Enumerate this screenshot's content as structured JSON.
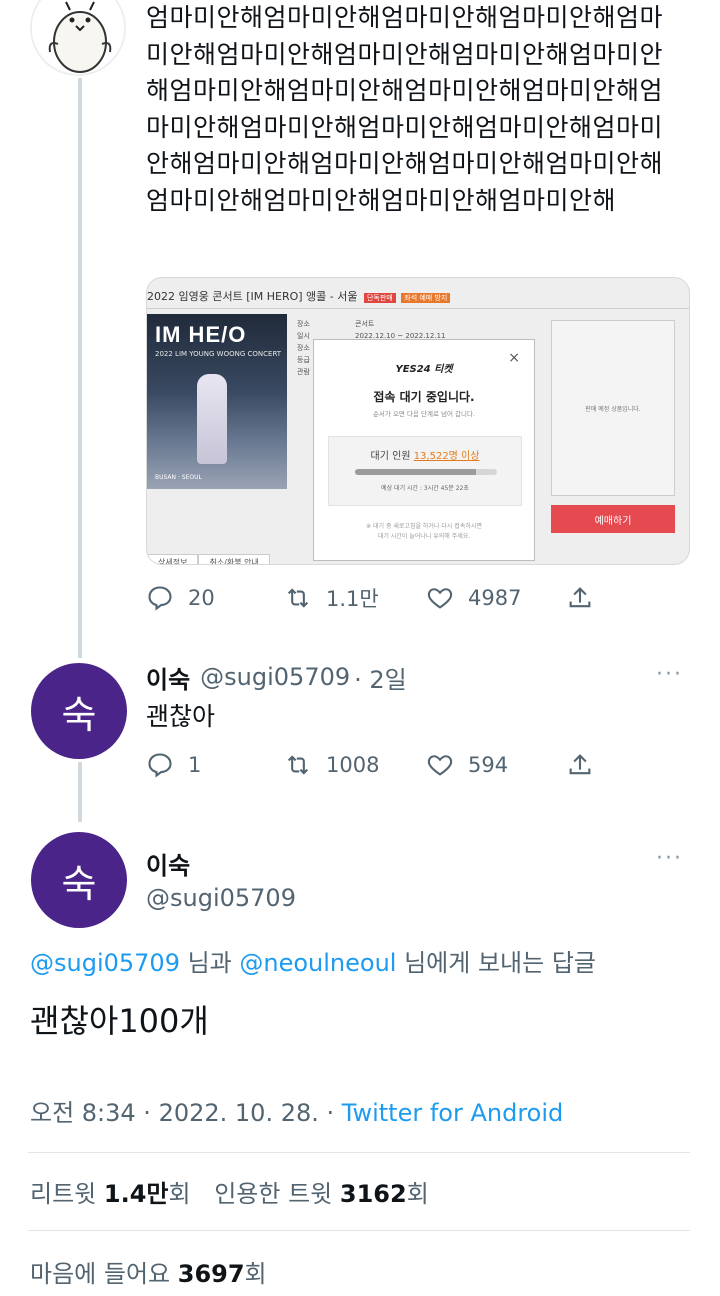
{
  "first_tweet": {
    "text": "엄마미안해엄마미안해엄마미안해엄마미안해엄마미안해엄마미안해엄마미안해엄마미안해엄마미안해엄마미안해엄마미안해엄마미안해엄마미안해엄마미안해엄마미안해엄마미안해엄마미안해엄마미안해엄마미안해엄마미안해엄마미안해엄마미안해엄마미안해엄마미안해엄마미안해엄마미안해",
    "image": {
      "topbar": "2022 임영웅 콘서트 [IM HERO] 앵콜 - 서울",
      "badge1": "단독판매",
      "badge2": "좌석 예매 방지",
      "poster_title": "IM HE/O",
      "poster_sub": "2022 LIM YOUNG WOONG CONCERT",
      "poster_foot": "BUSAN · SEOUL",
      "info_rows": [
        "장소",
        "일시",
        "장소",
        "등급",
        "관람"
      ],
      "info_values": [
        "콘서트",
        "2022.12.10 ~ 2022.12.11"
      ],
      "side_text": "판매 예정 상품입니다.",
      "book_button": "예매하기",
      "tab1": "상세정보",
      "tab2": "취소/환불 안내",
      "modal": {
        "logo": "YES24 티켓",
        "close": "×",
        "title": "접속 대기 중입니다.",
        "subtitle": "순서가 오면 다음 단계로 넘어 갑니다.",
        "count_label": "대기 인원",
        "count_value": "13,522명 이상",
        "eta": "예상 대기 시간 : 3시간 45분 22초",
        "note_line1": "※ 대기 중 새로고침을 하거나 다시 접속하시면",
        "note_line2": "대기 시간이 늘어나니 유의해 주세요.",
        "progress": 0.85
      }
    },
    "replies": "20",
    "retweets": "1.1만",
    "likes": "4987"
  },
  "reply": {
    "avatar_text": "숙",
    "name": "이숙",
    "handle": "@sugi05709",
    "time": "· 2일",
    "more": "···",
    "text": "괜찮아",
    "replies": "1",
    "retweets": "1008",
    "likes": "594"
  },
  "main_tweet": {
    "avatar_text": "숙",
    "name": "이숙",
    "handle": "@sugi05709",
    "more": "···",
    "reply_to_user1": "@sugi05709",
    "reply_mid": " 님과 ",
    "reply_to_user2": "@neoulneoul",
    "reply_end": " 님에게 보내는 답글",
    "text": "괜찮아100개",
    "timestamp": "오전 8:34 · 2022. 10. 28. · ",
    "source": "Twitter for Android",
    "retweets_label": "리트윗 ",
    "retweets_value": "1.4만",
    "retweets_unit": "회",
    "quotes_label": "인용한 트윗 ",
    "quotes_value": "3162",
    "quotes_unit": "회",
    "likes_label": "마음에 들어요 ",
    "likes_value": "3697",
    "likes_unit": "회"
  },
  "colors": {
    "accent": "#1d9bf0",
    "avatar": "#4a2489",
    "secondary_text": "#536471",
    "thread_line": "#cfd9de"
  }
}
